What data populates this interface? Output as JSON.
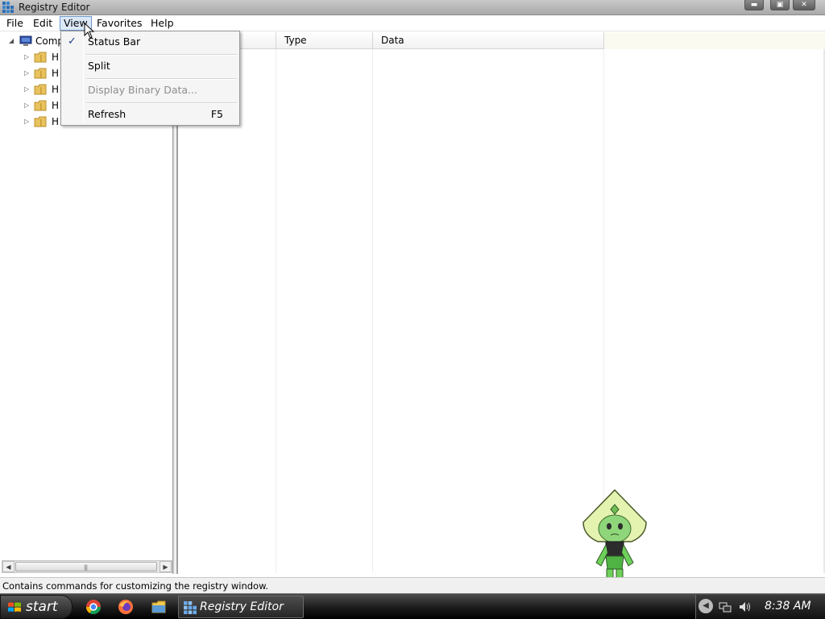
{
  "window": {
    "title": "Registry Editor"
  },
  "menubar": {
    "items": [
      "File",
      "Edit",
      "View",
      "Favorites",
      "Help"
    ]
  },
  "tree": {
    "root_label": "Comp",
    "child_labels": [
      "H",
      "H",
      "H",
      "H",
      "H"
    ]
  },
  "list": {
    "columns": [
      "",
      "Type",
      "Data"
    ]
  },
  "view_menu": {
    "items": [
      {
        "label": "Status Bar",
        "checked": true,
        "enabled": true,
        "shortcut": ""
      },
      {
        "label": "Split",
        "checked": false,
        "enabled": true,
        "shortcut": ""
      },
      {
        "label": "Display Binary Data...",
        "checked": false,
        "enabled": false,
        "shortcut": ""
      },
      {
        "label": "Refresh",
        "checked": false,
        "enabled": true,
        "shortcut": "F5"
      }
    ]
  },
  "statusbar": {
    "text": "Contains commands for customizing the registry window."
  },
  "taskbar": {
    "start_label": "start",
    "task_label": "Registry Editor",
    "clock": "8:38 AM"
  },
  "colors": {
    "menu_highlight": "#dbe8f7",
    "check": "#1d3e86",
    "folder": "#e7c25f"
  }
}
